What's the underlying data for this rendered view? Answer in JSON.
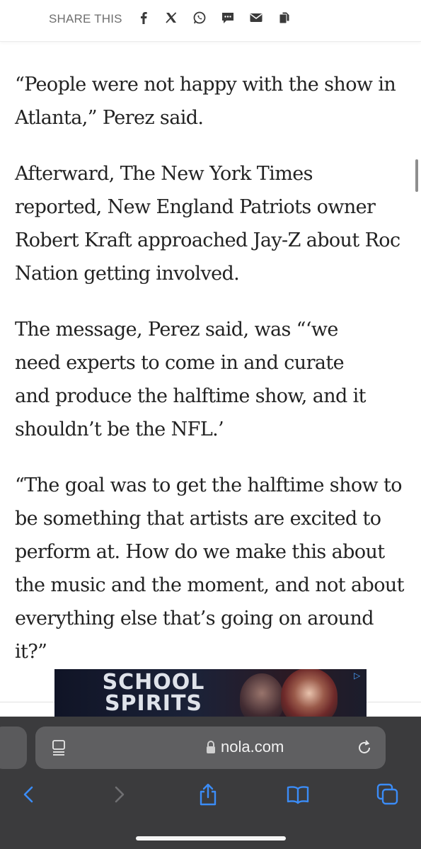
{
  "share_bar": {
    "label": "SHARE THIS",
    "icons": [
      "facebook-icon",
      "x-icon",
      "whatsapp-icon",
      "sms-icon",
      "email-icon",
      "copy-icon"
    ],
    "icon_color": "#3a3a3a"
  },
  "article": {
    "paragraphs": [
      "“People were not happy with the show in Atlanta,” Perez said.",
      "Afterward, The New York Times reported, New England Patriots owner Robert Kraft approached Jay-Z about Roc Nation getting involved.",
      "The message, Perez said, was “‘we need experts to come in and curate and produce the halftime show, and it shouldn’t be the NFL.’",
      "“The goal was to get the halftime show to be something that artists are excited to perform at. How do we make this about the music and the moment, and not about everything else that’s going on around it?”"
    ]
  },
  "ad": {
    "title_line1": "SCHOOL",
    "title_line2": "SPIRITS",
    "badge_icon": "adchoices-icon"
  },
  "browser": {
    "url": "nola.com",
    "reader_icon": "reader-icon",
    "lock_icon": "lock-icon",
    "reload_icon": "reload-icon",
    "accent": "#3b8cf7",
    "toolbar": [
      "back-icon",
      "forward-icon",
      "share-icon",
      "bookmarks-icon",
      "tabs-icon"
    ]
  }
}
